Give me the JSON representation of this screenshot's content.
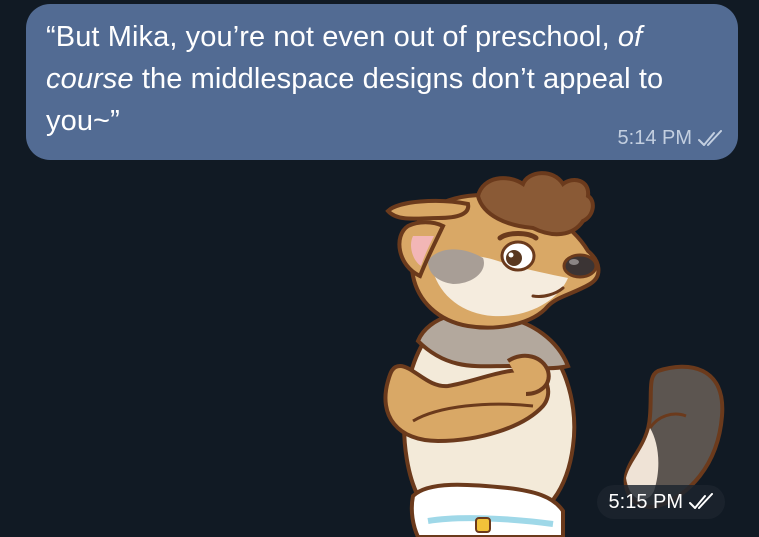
{
  "messages": [
    {
      "text_before_italic": "“But Mika, you’re not even out of preschool, ",
      "italic": "of course",
      "text_after_italic": " the middlespace designs don’t appeal to you~”",
      "time": "5:14 PM",
      "status": "read-double-check-icon"
    },
    {
      "type": "sticker",
      "sticker_description_icon": "canine-character-arms-crossed-sticker",
      "time": "5:15 PM",
      "status": "read-double-check-icon"
    }
  ],
  "colors": {
    "background": "#111a24",
    "outgoing_bubble": "#526b93",
    "meta_text": "#c3cfe0"
  }
}
